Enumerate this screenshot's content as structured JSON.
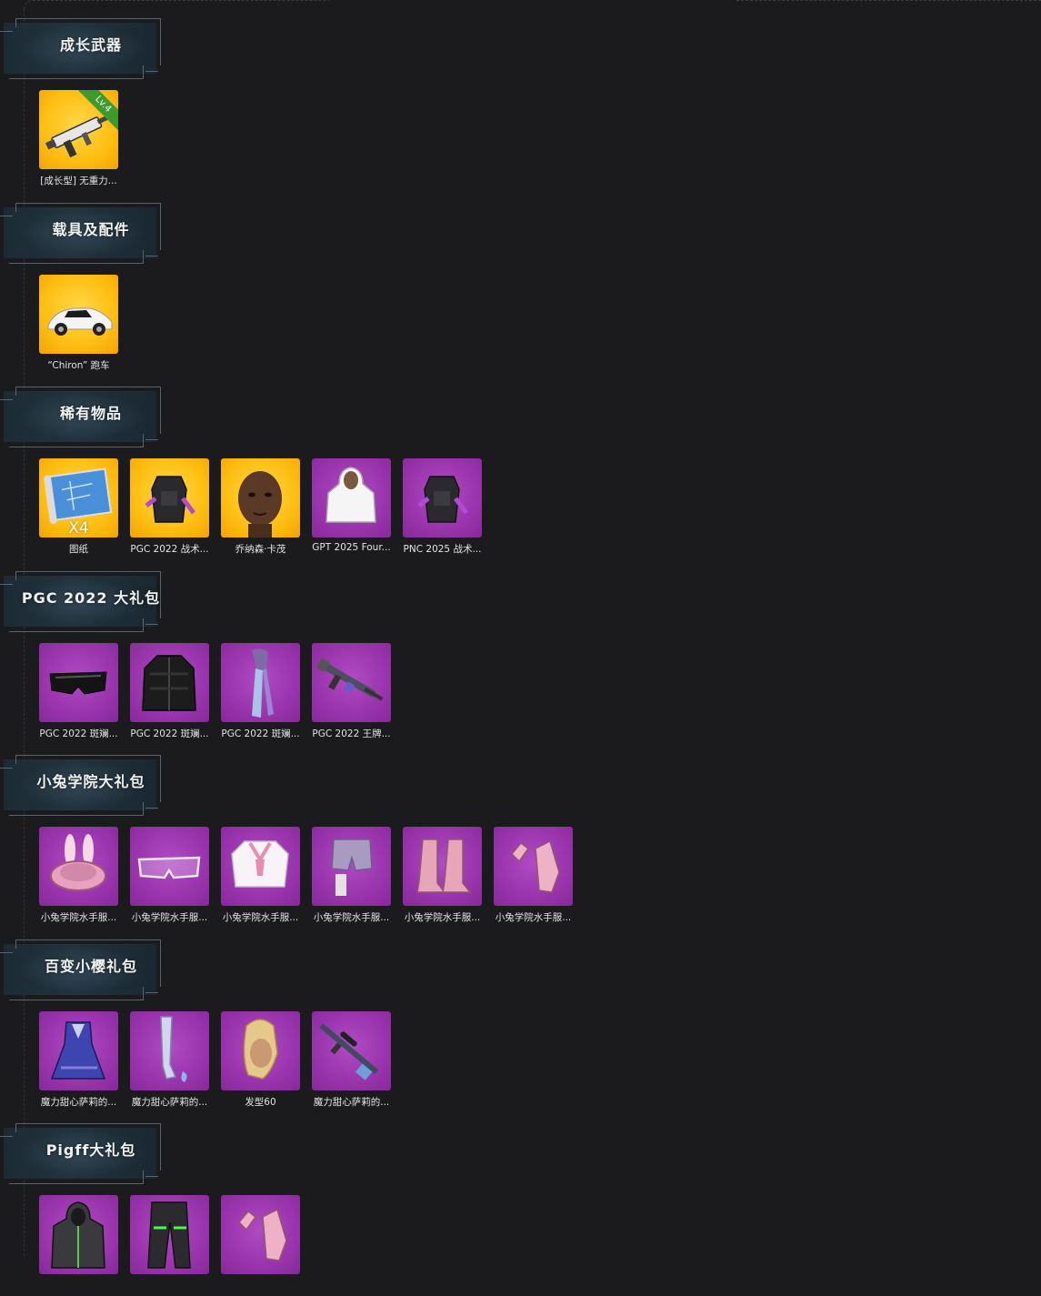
{
  "sections": [
    {
      "title": "成长武器",
      "items": [
        {
          "label": "[成长型] 无重力...",
          "rarity": "gold",
          "icon": "smg-weapon-icon",
          "badge": "Lv.4"
        }
      ]
    },
    {
      "title": "载具及配件",
      "items": [
        {
          "label": "“Chiron” 跑车",
          "rarity": "gold",
          "icon": "sports-car-icon"
        }
      ]
    },
    {
      "title": "稀有物品",
      "items": [
        {
          "label": "图纸",
          "rarity": "gold",
          "icon": "blueprint-icon",
          "qty": "X4"
        },
        {
          "label": "PGC 2022 战术...",
          "rarity": "gold",
          "icon": "backpack-icon"
        },
        {
          "label": "乔纳森·卡茂",
          "rarity": "gold",
          "icon": "character-face-icon"
        },
        {
          "label": "GPT 2025 Four...",
          "rarity": "purple",
          "icon": "hoodie-icon"
        },
        {
          "label": "PNC 2025 战术...",
          "rarity": "purple",
          "icon": "backpack-icon"
        }
      ]
    },
    {
      "title": "PGC 2022 大礼包",
      "items": [
        {
          "label": "PGC 2022 斑斓...",
          "rarity": "purple",
          "icon": "goggles-icon"
        },
        {
          "label": "PGC 2022 斑斓...",
          "rarity": "purple",
          "icon": "jacket-icon"
        },
        {
          "label": "PGC 2022 斑斓...",
          "rarity": "purple",
          "icon": "scarf-icon"
        },
        {
          "label": "PGC 2022 王牌...",
          "rarity": "purple",
          "icon": "rifle-icon"
        }
      ]
    },
    {
      "title": "小兔学院大礼包",
      "items": [
        {
          "label": "小兔学院水手服...",
          "rarity": "purple",
          "icon": "bunny-hat-icon"
        },
        {
          "label": "小兔学院水手服...",
          "rarity": "purple",
          "icon": "glasses-icon"
        },
        {
          "label": "小兔学院水手服...",
          "rarity": "purple",
          "icon": "sailor-top-icon"
        },
        {
          "label": "小兔学院水手服...",
          "rarity": "purple",
          "icon": "shorts-icon"
        },
        {
          "label": "小兔学院水手服...",
          "rarity": "purple",
          "icon": "boots-icon"
        },
        {
          "label": "小兔学院水手服...",
          "rarity": "purple",
          "icon": "gloves-icon"
        }
      ]
    },
    {
      "title": "百变小樱礼包",
      "items": [
        {
          "label": "魔力甜心萨莉的...",
          "rarity": "purple",
          "icon": "dress-icon"
        },
        {
          "label": "魔力甜心萨莉的...",
          "rarity": "purple",
          "icon": "stockings-icon"
        },
        {
          "label": "发型60",
          "rarity": "purple",
          "icon": "hairstyle-icon"
        },
        {
          "label": "魔力甜心萨莉的...",
          "rarity": "purple",
          "icon": "sniper-rifle-icon"
        }
      ]
    },
    {
      "title": "Pigff大礼包",
      "items": [
        {
          "label": "",
          "rarity": "purple",
          "icon": "hooded-jacket-icon"
        },
        {
          "label": "",
          "rarity": "purple",
          "icon": "pants-icon"
        },
        {
          "label": "",
          "rarity": "purple",
          "icon": "gloves-icon"
        }
      ]
    }
  ],
  "colors": {
    "gold": "#ffbe12",
    "purple": "#9a34ad",
    "background": "#1b1b1d"
  }
}
